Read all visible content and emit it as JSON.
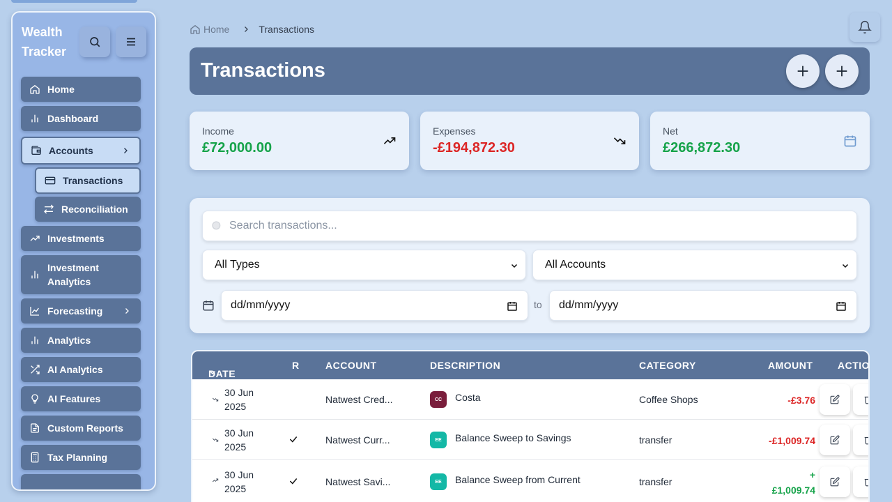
{
  "app": {
    "brand": "Wealth Tracker"
  },
  "sidebar": {
    "items": [
      {
        "label": "Home",
        "icon": "home-icon"
      },
      {
        "label": "Dashboard",
        "icon": "bar-chart-icon"
      },
      {
        "label": "Accounts",
        "icon": "wallet-icon",
        "expanded": true
      },
      {
        "label": "Transactions",
        "icon": "credit-card-icon",
        "sub": true,
        "active": true
      },
      {
        "label": "Reconciliation",
        "icon": "arrows-swap-icon",
        "sub": true
      },
      {
        "label": "Investments",
        "icon": "trending-up-icon"
      },
      {
        "label": "Investment Analytics",
        "icon": "bar-chart-icon"
      },
      {
        "label": "Forecasting",
        "icon": "line-chart-icon"
      },
      {
        "label": "Analytics",
        "icon": "bar-chart-icon"
      },
      {
        "label": "AI Analytics",
        "icon": "shuffle-icon"
      },
      {
        "label": "AI Features",
        "icon": "lightbulb-icon"
      },
      {
        "label": "Custom Reports",
        "icon": "file-icon"
      },
      {
        "label": "Tax Planning",
        "icon": "calculator-icon"
      }
    ]
  },
  "breadcrumb": {
    "home": "Home",
    "current": "Transactions"
  },
  "header": {
    "title": "Transactions"
  },
  "stats": {
    "income": {
      "label": "Income",
      "value": "£72,000.00"
    },
    "expenses": {
      "label": "Expenses",
      "value": "-£194,872.30"
    },
    "net": {
      "label": "Net",
      "value": "£266,872.30"
    }
  },
  "filters": {
    "search_placeholder": "Search transactions...",
    "type_value": "All Types",
    "account_value": "All Accounts",
    "date_from": "dd/mm/yyyy",
    "date_to": "dd/mm/yyyy",
    "to_label": "to"
  },
  "table": {
    "columns": {
      "date": "DATE",
      "r": "R",
      "account": "ACCOUNT",
      "description": "DESCRIPTION",
      "category": "CATEGORY",
      "amount": "AMOUNT",
      "actions": "ACTIONS"
    },
    "rows": [
      {
        "date1": "30 Jun",
        "date2": "2025",
        "reconciled": false,
        "account": "Natwest Cred...",
        "avatar": "CC",
        "avatar_color": "#7a1e3c",
        "description": "Costa",
        "category": "Coffee Shops",
        "amount": "-£3.76",
        "amount_color": "#dc2626"
      },
      {
        "date1": "30 Jun",
        "date2": "2025",
        "reconciled": true,
        "account": "Natwest Curr...",
        "avatar": "EE",
        "avatar_color": "#14b8a6",
        "description": "Balance Sweep to Savings",
        "category": "transfer",
        "amount": "-£1,009.74",
        "amount_color": "#dc2626"
      },
      {
        "date1": "30 Jun",
        "date2": "2025",
        "reconciled": true,
        "account": "Natwest Savi...",
        "avatar": "EE",
        "avatar_color": "#14b8a6",
        "description": "Balance Sweep from Current",
        "category": "transfer",
        "amount1": "+",
        "amount2": "£1,009.74",
        "amount_color": "#16a34a"
      }
    ]
  }
}
